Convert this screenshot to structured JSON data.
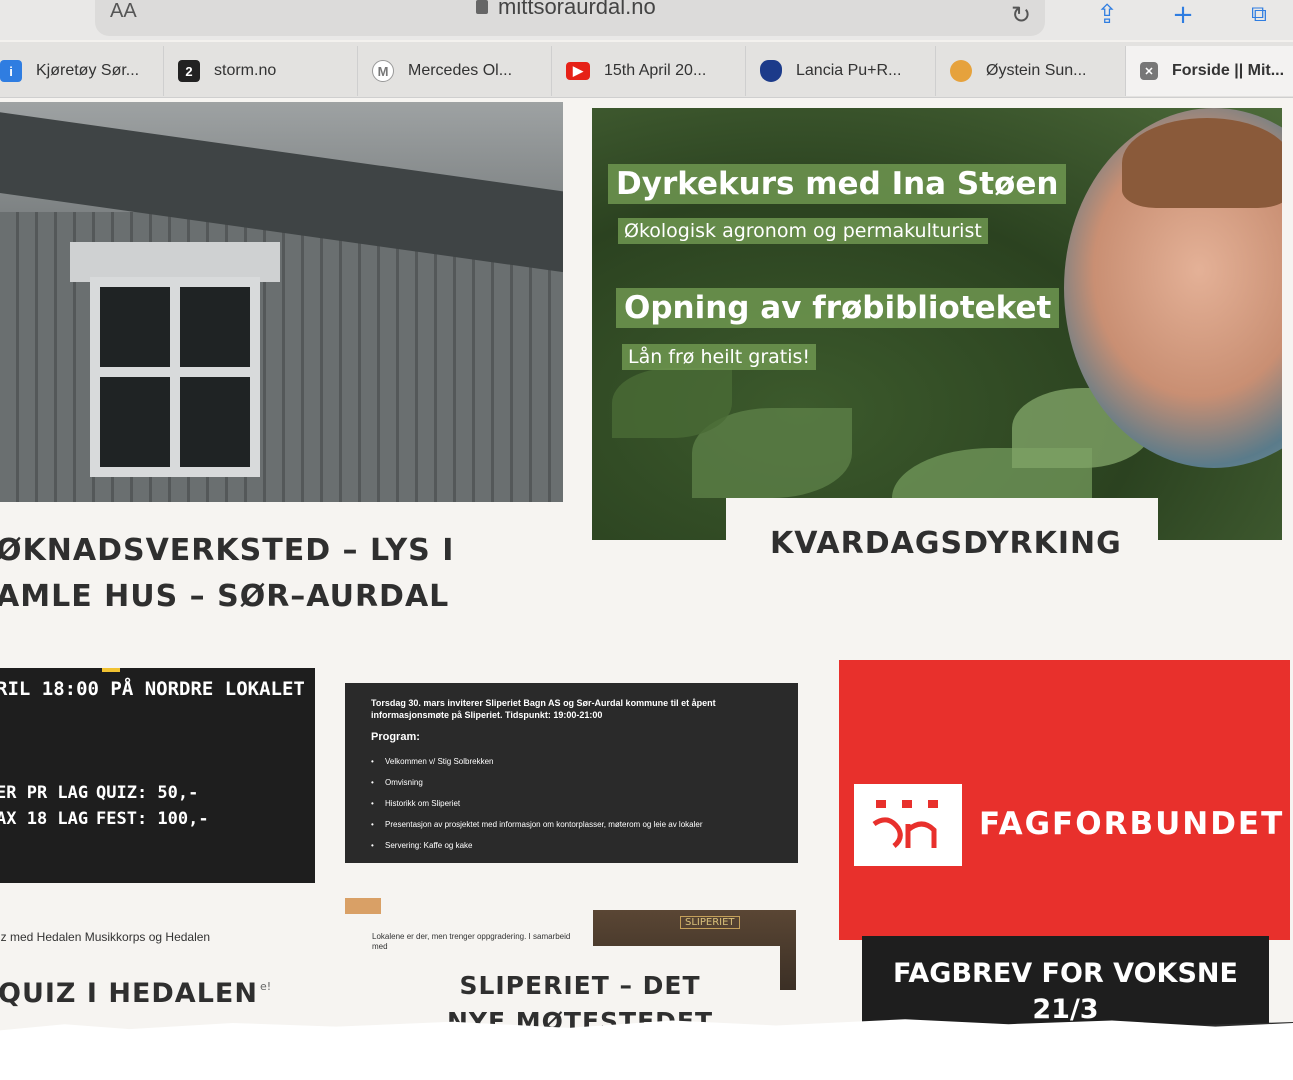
{
  "browser": {
    "reader_label": "AA",
    "url": "mittsoraurdal.no",
    "tabs": [
      {
        "label": "Kjøretøy Sør...",
        "icon": "car-favicon"
      },
      {
        "label": "storm.no",
        "icon": "storm-favicon",
        "badge": "2"
      },
      {
        "label": "Mercedes Ol...",
        "icon": "mercedes-favicon",
        "badge": "M"
      },
      {
        "label": "15th April 20...",
        "icon": "youtube-favicon"
      },
      {
        "label": "Lancia Pu+R...",
        "icon": "shield-favicon"
      },
      {
        "label": "Øystein Sun...",
        "icon": "badge-favicon"
      },
      {
        "label": "Forside || Mit...",
        "icon": "close-tab-favicon"
      }
    ]
  },
  "cards": {
    "house": {
      "title": "ØKNADSVERKSTED – LYS I AMLE HUS – SØR–AURDAL"
    },
    "garden": {
      "overlay_title_1": "Dyrkekurs med Ina Støen",
      "overlay_sub_1": "Økologisk agronom og permakulturist",
      "overlay_title_2": "Opning av frøbiblioteket",
      "overlay_sub_2": "Lån frø heilt gratis!",
      "title": "KVARDAGSDYRKING"
    },
    "quiz": {
      "banner_line": "RIL 18:00 PÅ NORDRE LOKALET",
      "col1_line1": "ER PR LAG",
      "col1_line2": "AX 18 LAG",
      "col2_line1": "QUIZ: 50,-",
      "col2_line2": "FEST: 100,-",
      "desc": "iz med Hedalen Musikkorps og Hedalen",
      "mark": "e!",
      "title": "QUIZ I HEDALEN"
    },
    "slip": {
      "intro": "Torsdag  30. mars inviterer Sliperiet Bagn AS og Sør-Aurdal kommune til et åpent informasjonsmøte på Sliperiet. Tidspunkt: 19:00-21:00",
      "program_label": "Program:",
      "program": [
        "Velkommen v/ Stig Solbrekken",
        "Omvisning",
        "Historikk om Sliperiet",
        "Presentasjon av prosjektet med informasjon om kontorplasser, møterom og leie av lokaler",
        "Servering: Kaffe og kake"
      ],
      "small_text": "Lokalene er der, men trenger oppgradering. I samarbeid med",
      "sign": "SLIPERIET",
      "title": "SLIPERIET – DET NYE MØTESTEDET I BAGN"
    },
    "fag": {
      "logo_text": "FAGFORBUNDET",
      "title": "FAGBREV FOR VOKSNE 21/3"
    }
  },
  "colors": {
    "fag_red": "#e8302c",
    "garden_green": "#6e9650",
    "dark_box": "#1e1e1e"
  }
}
